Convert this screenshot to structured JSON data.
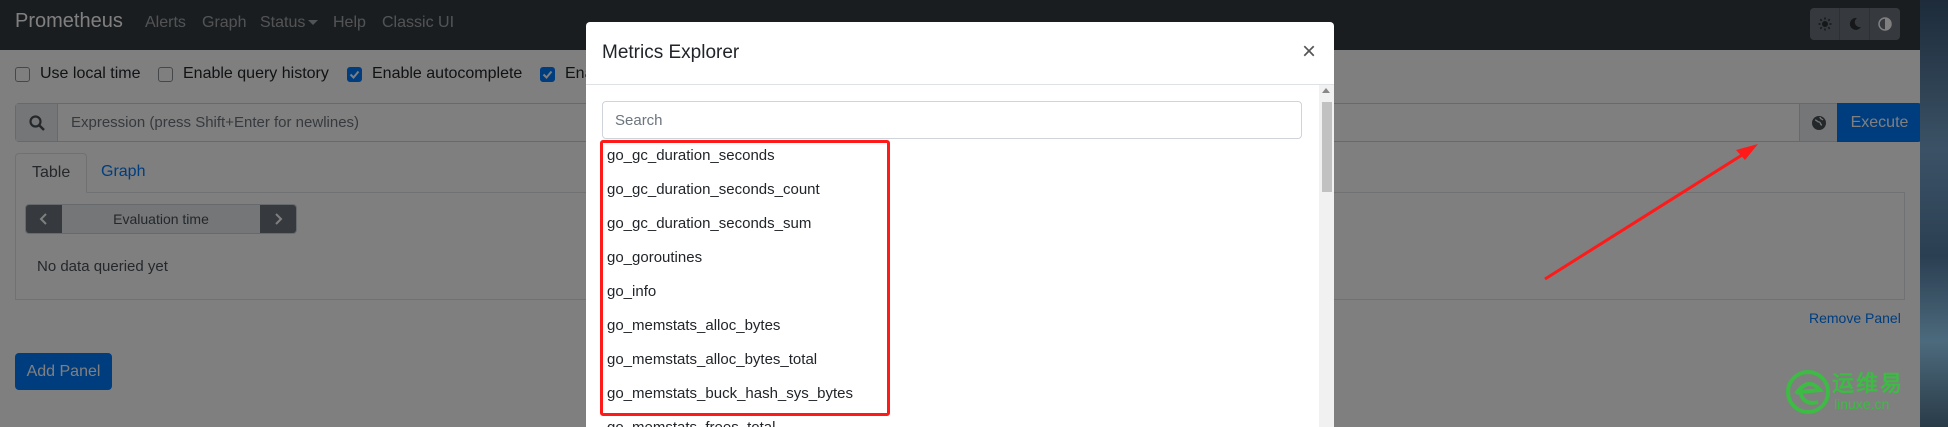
{
  "navbar": {
    "brand": "Prometheus",
    "links": [
      "Alerts",
      "Graph",
      "Status",
      "Help",
      "Classic UI"
    ]
  },
  "options": {
    "use_local_time": "Use local time",
    "enable_query_history": "Enable query history",
    "enable_autocomplete": "Enable autocomplete",
    "enable_partial": "Ena"
  },
  "expression": {
    "placeholder": "Expression (press Shift+Enter for newlines)",
    "execute_label": "Execute"
  },
  "panel": {
    "tabs": [
      "Table",
      "Graph"
    ],
    "eval_time_label": "Evaluation time",
    "no_data": "No data queried yet",
    "remove_panel": "Remove Panel"
  },
  "add_panel": "Add Panel",
  "modal": {
    "title": "Metrics Explorer",
    "close": "×",
    "search_placeholder": "Search",
    "metrics": [
      "go_gc_duration_seconds",
      "go_gc_duration_seconds_count",
      "go_gc_duration_seconds_sum",
      "go_goroutines",
      "go_info",
      "go_memstats_alloc_bytes",
      "go_memstats_alloc_bytes_total",
      "go_memstats_buck_hash_sys_bytes",
      "go_memstats_frees_total"
    ]
  },
  "watermark": {
    "cn": "运维易",
    "domain": "linuxe.cn"
  },
  "colors": {
    "navbar": "#343a40",
    "primary": "#007bff",
    "annotation": "#ff1a1a",
    "watermark": "#3dbb44"
  }
}
